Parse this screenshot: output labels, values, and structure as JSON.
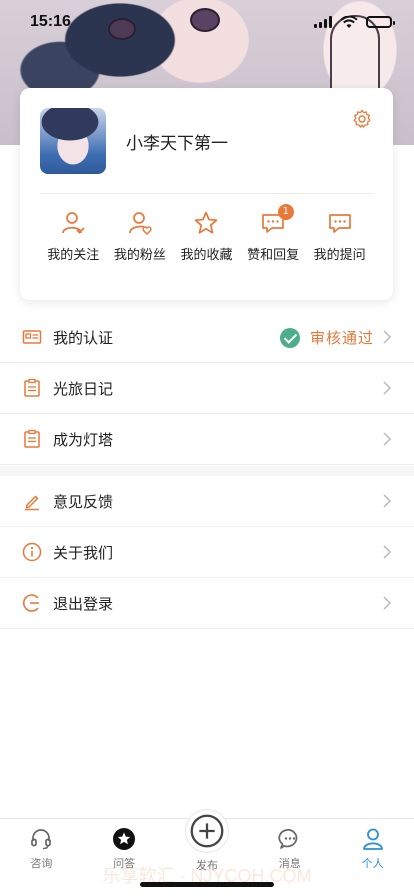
{
  "status_bar": {
    "time": "15:16"
  },
  "profile": {
    "username": "小李天下第一"
  },
  "actions": [
    {
      "label": "我的关注",
      "icon": "user-follow-icon"
    },
    {
      "label": "我的粉丝",
      "icon": "user-heart-icon"
    },
    {
      "label": "我的收藏",
      "icon": "star-icon"
    },
    {
      "label": "赞和回复",
      "icon": "comment-icon",
      "badge": "1"
    },
    {
      "label": "我的提问",
      "icon": "question-bubble-icon"
    }
  ],
  "menu_group_1": [
    {
      "label": "我的认证",
      "icon": "id-card-icon",
      "status": "审核通过"
    },
    {
      "label": "光旅日记",
      "icon": "clipboard-icon"
    },
    {
      "label": "成为灯塔",
      "icon": "clipboard-icon"
    }
  ],
  "menu_group_2": [
    {
      "label": "意见反馈",
      "icon": "pencil-icon"
    },
    {
      "label": "关于我们",
      "icon": "info-icon"
    },
    {
      "label": "退出登录",
      "icon": "logout-icon"
    }
  ],
  "tabs": [
    {
      "label": "咨询",
      "icon": "headset-icon"
    },
    {
      "label": "问答",
      "icon": "star-circle-icon"
    },
    {
      "label": "发布",
      "icon": "plus-circle-icon"
    },
    {
      "label": "消息",
      "icon": "chat-icon"
    },
    {
      "label": "个人",
      "icon": "person-icon",
      "active": true
    }
  ],
  "watermark": "乐享软汇 · NJYCOH.COM",
  "colors": {
    "accent": "#e8793a",
    "active_tab": "#2b8fd6",
    "success": "#4cae8a"
  }
}
